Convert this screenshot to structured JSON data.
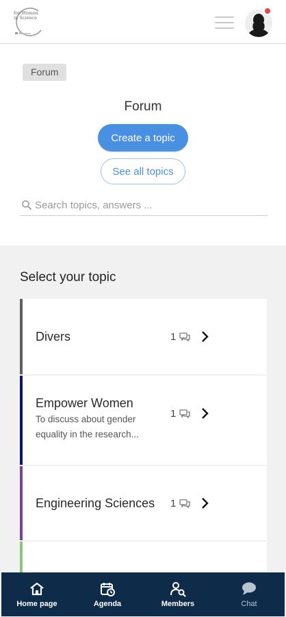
{
  "header": {
    "logo_text": "for Women in Science",
    "logo_icon": "for-women-in-science-logo",
    "menu_icon": "hamburger-menu-icon",
    "avatar_icon": "user-avatar-icon",
    "notification_color": "#e8424b"
  },
  "forum": {
    "breadcrumb": "Forum",
    "title": "Forum",
    "create_label": "Create a topic",
    "see_all_label": "See all topics",
    "search_placeholder": "Search topics, answers ...",
    "accent": "#4a90e2"
  },
  "topics_section": {
    "title": "Select your topic",
    "topics": [
      {
        "name": "Divers",
        "description": "",
        "count": "1",
        "color": "#5e5e5e"
      },
      {
        "name": "Empower Women",
        "description": "To discuss about gender equality in the research...",
        "count": "1",
        "color": "#0d1470"
      },
      {
        "name": "Engineering Sciences",
        "description": "",
        "count": "1",
        "color": "#7b3fa0"
      },
      {
        "name": "",
        "description": "",
        "count": "",
        "color": "#8cc47a"
      }
    ]
  },
  "bottom_nav": {
    "background": "#0f2b4a",
    "items": [
      {
        "label": "Home page",
        "icon": "home-icon"
      },
      {
        "label": "Agenda",
        "icon": "calendar-icon"
      },
      {
        "label": "Members",
        "icon": "members-search-icon"
      },
      {
        "label": "Chat",
        "icon": "chat-icon"
      }
    ]
  }
}
